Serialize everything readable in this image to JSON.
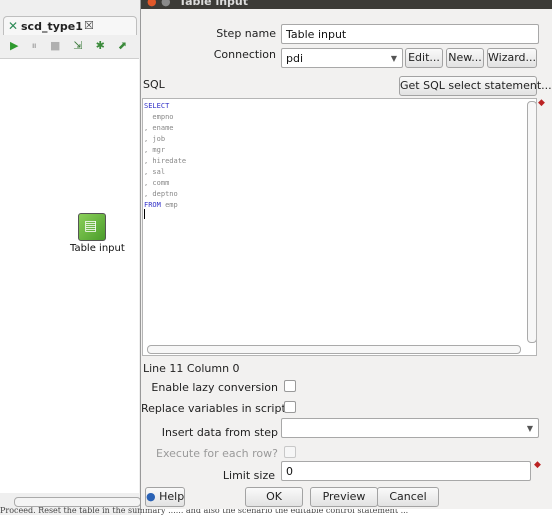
{
  "background_editor": {
    "tab": {
      "label": "scd_type1",
      "close_glyph": "☒"
    },
    "run_toolbar": [
      {
        "name": "run-icon",
        "glyph": "▶",
        "color": "#2e9a2e"
      },
      {
        "name": "pause-icon",
        "glyph": "⏸",
        "color": "#b0b0b0"
      },
      {
        "name": "stop-icon",
        "glyph": "■",
        "color": "#b0b0b0"
      },
      {
        "name": "preview-icon",
        "glyph": "⇲",
        "color": "#3a7a3a"
      },
      {
        "name": "debug-icon",
        "glyph": "✱",
        "color": "#3a8a3a"
      },
      {
        "name": "replay-icon",
        "glyph": "⬈",
        "color": "#3a8a3a"
      }
    ],
    "step": {
      "label": "Table input",
      "icon": "table-input-icon"
    },
    "bottom_text": "Proceed. Reset the table in the summary ...... and also the scenario the editable control statement ..."
  },
  "dialog": {
    "title": "Table input",
    "step_name": {
      "label": "Step name",
      "value": "Table input"
    },
    "connection": {
      "label": "Connection",
      "value": "pdi",
      "buttons": {
        "edit": "Edit...",
        "new": "New...",
        "wizard": "Wizard..."
      }
    },
    "sql": {
      "label": "SQL",
      "get_sql_button": "Get SQL select statement...",
      "lines": [
        {
          "text": "SELECT",
          "kind": "kw"
        },
        {
          "text": "  empno",
          "kind": "txt"
        },
        {
          "text": ", ename",
          "kind": "txt"
        },
        {
          "text": ", job",
          "kind": "txt"
        },
        {
          "text": ", mgr",
          "kind": "txt"
        },
        {
          "text": ", hiredate",
          "kind": "txt"
        },
        {
          "text": ", sal",
          "kind": "txt"
        },
        {
          "text": ", comm",
          "kind": "txt"
        },
        {
          "text": ", deptno",
          "kind": "txt"
        },
        {
          "text": "FROM emp",
          "kind": "mixed"
        }
      ],
      "from_keyword": "FROM",
      "from_table": " emp",
      "status": "Line 11 Column 0"
    },
    "options": {
      "lazy_conversion": {
        "label": "Enable lazy conversion",
        "checked": false
      },
      "replace_variables": {
        "label": "Replace variables in script?",
        "checked": false
      },
      "insert_data_from_step": {
        "label": "Insert data from step",
        "value": ""
      },
      "execute_each_row": {
        "label": "Execute for each row?",
        "checked": false,
        "enabled": false
      },
      "limit_size": {
        "label": "Limit size",
        "value": "0"
      }
    },
    "footer": {
      "help": "Help",
      "ok": "OK",
      "preview": "Preview",
      "cancel": "Cancel"
    },
    "colors": {
      "keyword": "#3232c8",
      "text": "#888888",
      "titlebar": "#3c3b37"
    }
  }
}
